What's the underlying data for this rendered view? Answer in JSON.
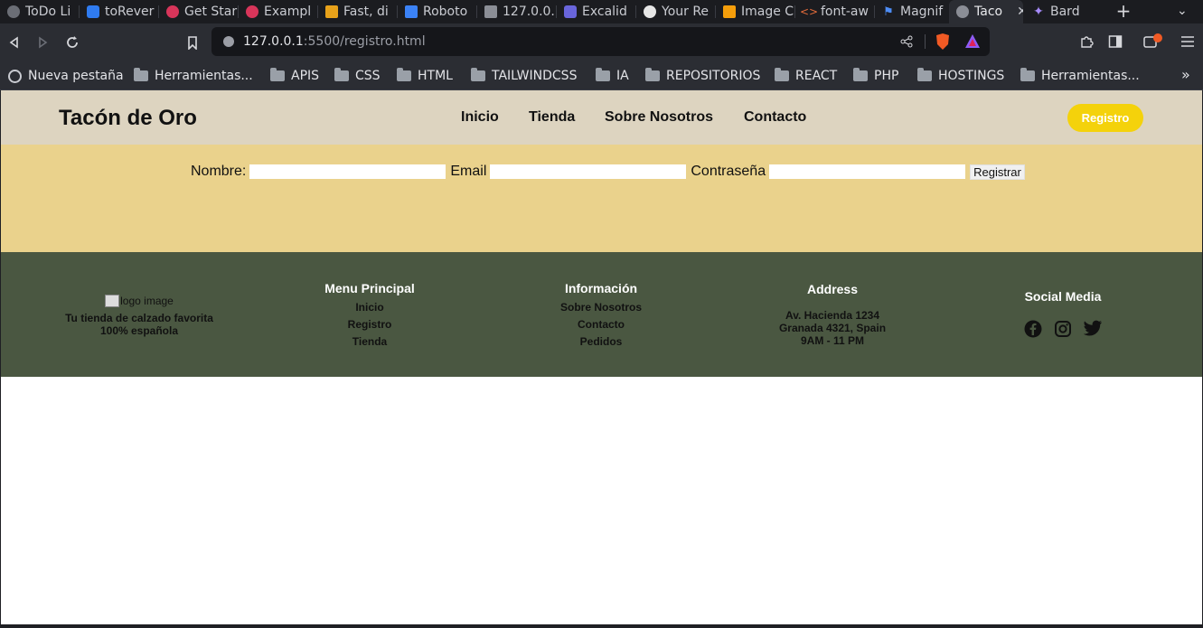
{
  "tabs": [
    {
      "label": "ToDo Li",
      "icon": "globe-icon"
    },
    {
      "label": "toRever",
      "icon": "jira-icon"
    },
    {
      "label": "Get Star",
      "icon": "qwik-icon"
    },
    {
      "label": "Exampl",
      "icon": "qwik-icon"
    },
    {
      "label": "Fast, di",
      "icon": "grid-icon"
    },
    {
      "label": "Roboto",
      "icon": "fonts-icon"
    },
    {
      "label": "127.0.0.",
      "icon": "mountain-icon"
    },
    {
      "label": "Excalid",
      "icon": "excalidraw-icon"
    },
    {
      "label": "Your Re",
      "icon": "github-icon"
    },
    {
      "label": "Image C",
      "icon": "image-icon"
    },
    {
      "label": "font-aw",
      "icon": "code-icon"
    },
    {
      "label": "Magnif",
      "icon": "flag-icon"
    },
    {
      "label": "Taco",
      "icon": "globe-icon",
      "active": true
    },
    {
      "label": "Bard",
      "icon": "sparkle-icon"
    }
  ],
  "address": {
    "host": "127.0.0.1",
    "rest": ":5500/registro.html"
  },
  "bookmarks": [
    "Nueva pestaña",
    "Herramientas...",
    "APIS",
    "CSS",
    "HTML",
    "TAILWINDCSS",
    "IA",
    "REPOSITORIOS",
    "REACT",
    "PHP",
    "HOSTINGS",
    "Herramientas..."
  ],
  "site": {
    "brand": "Tacón de Oro",
    "nav": [
      "Inicio",
      "Tienda",
      "Sobre Nosotros",
      "Contacto"
    ],
    "register_button": "Registro"
  },
  "form": {
    "name_label": "Nombre:",
    "email_label": "Email",
    "password_label": "Contraseña",
    "submit": "Registrar"
  },
  "footer": {
    "logo_alt": "logo image",
    "tagline_1": "Tu tienda de calzado favorita",
    "tagline_2": "100% española",
    "menu_title": "Menu Principal",
    "menu_links": [
      "Inicio",
      "Registro",
      "Tienda"
    ],
    "info_title": "Información",
    "info_links": [
      "Sobre Nosotros",
      "Contacto",
      "Pedidos"
    ],
    "address_title": "Address",
    "address_lines": [
      "Av. Hacienda 1234",
      "Granada 4321, Spain",
      "9AM - 11 PM"
    ],
    "social_title": "Social Media"
  },
  "colors": {
    "header_bg": "#ddd4c0",
    "form_bg": "#ead28c",
    "footer_bg": "#4a5741",
    "register_btn": "#f4d20b"
  }
}
